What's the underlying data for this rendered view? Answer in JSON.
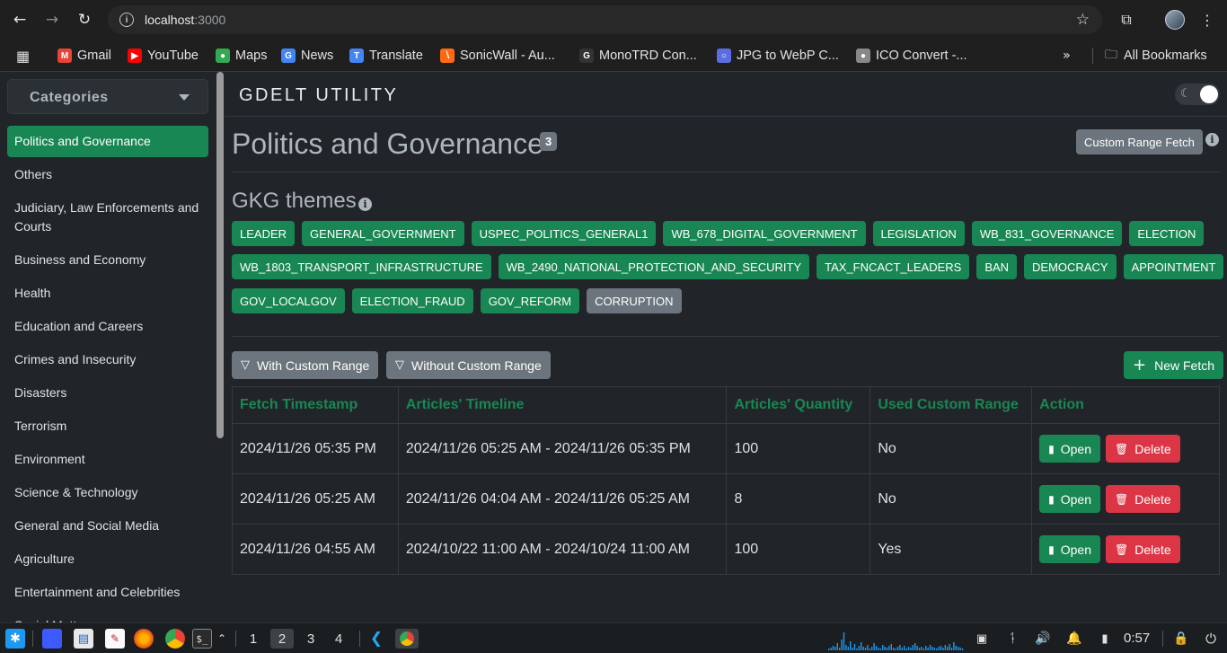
{
  "browser": {
    "url_host": "localhost",
    "url_port": ":3000",
    "bookmarks": [
      {
        "label": "Gmail",
        "icon": "gmail-icon",
        "color": "#ea4335"
      },
      {
        "label": "YouTube",
        "icon": "youtube-icon",
        "color": "#ff0000"
      },
      {
        "label": "Maps",
        "icon": "maps-icon",
        "color": "#34a853"
      },
      {
        "label": "News",
        "icon": "news-icon",
        "color": "#4285f4"
      },
      {
        "label": "Translate",
        "icon": "translate-icon",
        "color": "#4285f4"
      },
      {
        "label": "SonicWall - Au...",
        "icon": "sonicwall-icon",
        "color": "#ff6a13"
      },
      {
        "label": "MonoTRD Con...",
        "icon": "monotrd-icon",
        "color": "#333333"
      },
      {
        "label": "JPG to WebP C...",
        "icon": "jpg-webp-icon",
        "color": "#5b6ee1"
      },
      {
        "label": "ICO Convert -...",
        "icon": "ico-convert-icon",
        "color": "#888888"
      }
    ],
    "all_bookmarks": "All Bookmarks"
  },
  "sidebar": {
    "header": "Categories",
    "items": [
      {
        "label": "Politics and Governance",
        "active": true
      },
      {
        "label": "Others"
      },
      {
        "label": "Judiciary, Law Enforcements and Courts"
      },
      {
        "label": "Business and Economy"
      },
      {
        "label": "Health"
      },
      {
        "label": "Education and Careers"
      },
      {
        "label": "Crimes and Insecurity"
      },
      {
        "label": "Disasters"
      },
      {
        "label": "Terrorism"
      },
      {
        "label": "Environment"
      },
      {
        "label": "Science & Technology"
      },
      {
        "label": "General and Social Media"
      },
      {
        "label": "Agriculture"
      },
      {
        "label": "Entertainment and Celebrities"
      },
      {
        "label": "Social Matters"
      }
    ]
  },
  "app": {
    "title": "GDELT UTILITY",
    "page_title": "Politics and Governance",
    "count": "3",
    "custom_range_fetch": "Custom Range Fetch",
    "gkg_title": "GKG themes",
    "themes": [
      [
        "LEADER",
        "GENERAL_GOVERNMENT",
        "USPEC_POLITICS_GENERAL1",
        "WB_678_DIGITAL_GOVERNMENT",
        "LEGISLATION",
        "WB_831_GOVERNANCE",
        "ELECTION"
      ],
      [
        "WB_1803_TRANSPORT_INFRASTRUCTURE",
        "WB_2490_NATIONAL_PROTECTION_AND_SECURITY",
        "TAX_FNCACT_LEADERS",
        "BAN",
        "DEMOCRACY",
        "APPOINTMENT"
      ],
      [
        "GOV_LOCALGOV",
        "ELECTION_FRAUD",
        "GOV_REFORM",
        "CORRUPTION"
      ]
    ],
    "inactive_theme": "CORRUPTION",
    "filter_with": "With Custom Range",
    "filter_without": "Without Custom Range",
    "new_fetch": "New Fetch",
    "table": {
      "headers": [
        "Fetch Timestamp",
        "Articles' Timeline",
        "Articles' Quantity",
        "Used Custom Range",
        "Action"
      ],
      "rows": [
        [
          "2024/11/26 05:35 PM",
          "2024/11/26 05:25 AM - 2024/11/26 05:35 PM",
          "100",
          "No"
        ],
        [
          "2024/11/26 05:25 AM",
          "2024/11/26 04:04 AM - 2024/11/26 05:25 AM",
          "8",
          "No"
        ],
        [
          "2024/11/26 04:55 AM",
          "2024/10/22 11:00 AM - 2024/10/24 11:00 AM",
          "100",
          "Yes"
        ]
      ],
      "open_label": "Open",
      "delete_label": "Delete"
    },
    "accent": "#198754",
    "danger": "#dc3545"
  },
  "taskbar": {
    "workspaces": [
      "1",
      "2",
      "3",
      "4"
    ],
    "active_workspace": "2",
    "clock": "0:57"
  }
}
